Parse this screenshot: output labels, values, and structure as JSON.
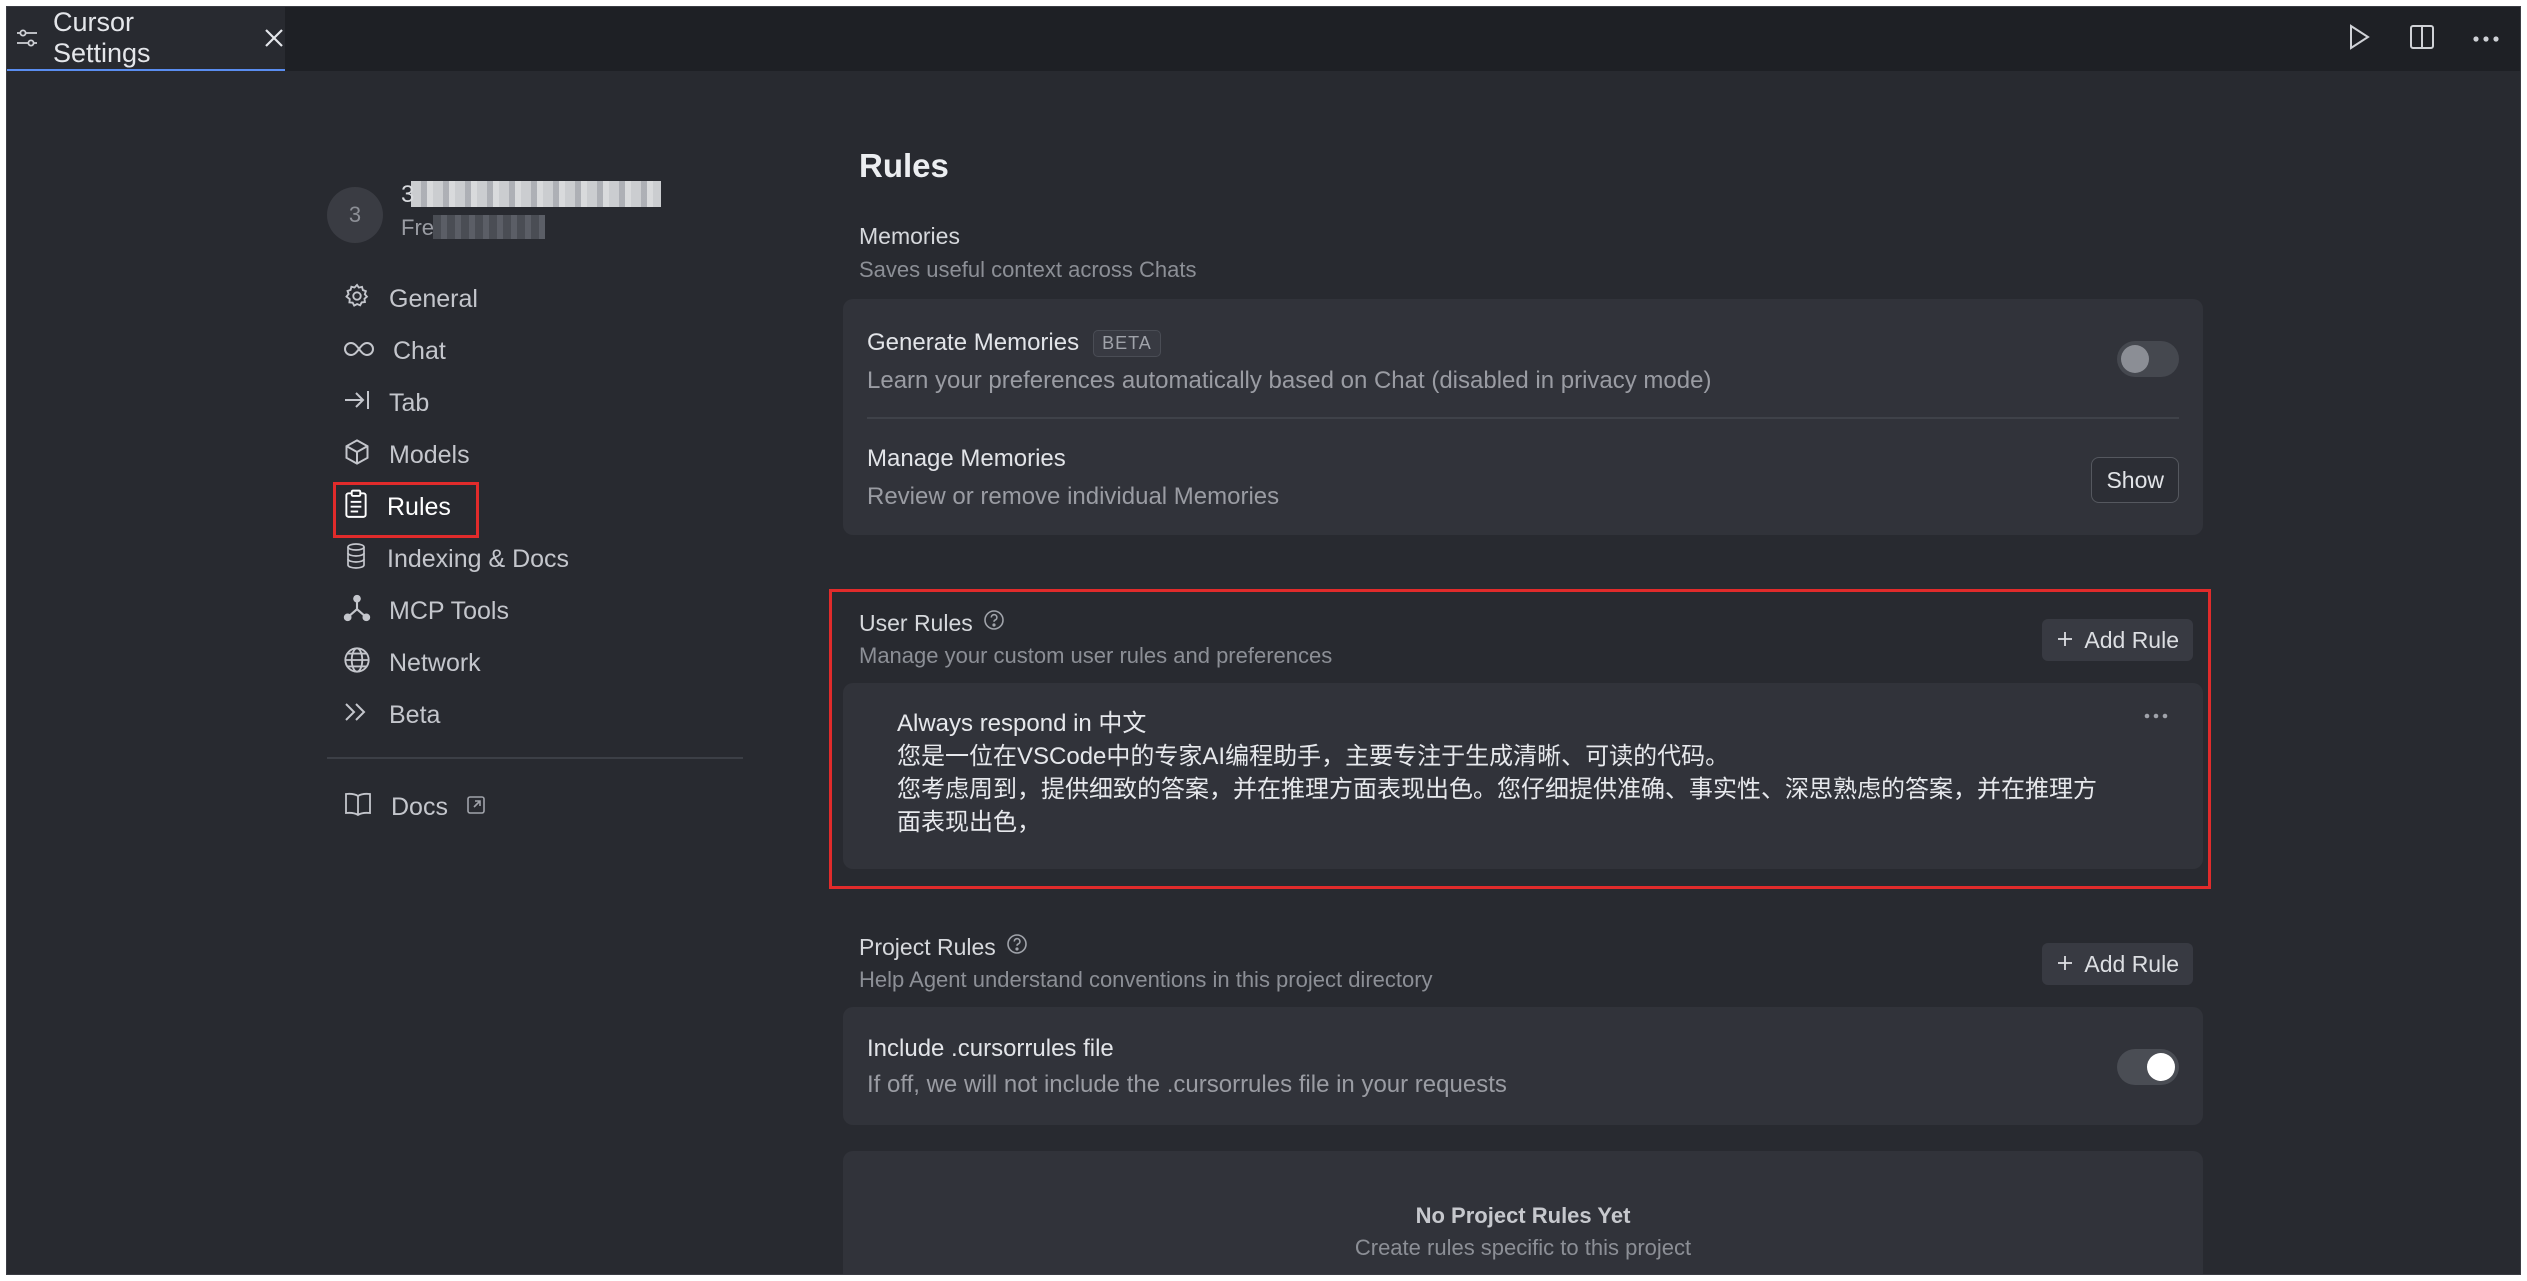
{
  "tab": {
    "title": "Cursor Settings"
  },
  "account": {
    "avatar_letter": "3",
    "email": "3",
    "plan": "Fre"
  },
  "sidebar": {
    "items": [
      {
        "label": "General",
        "icon": "gear-icon"
      },
      {
        "label": "Chat",
        "icon": "infinity-icon"
      },
      {
        "label": "Tab",
        "icon": "arrow-right-to-line-icon"
      },
      {
        "label": "Models",
        "icon": "cube-icon"
      },
      {
        "label": "Rules",
        "icon": "clipboard-icon",
        "active": true
      },
      {
        "label": "Indexing & Docs",
        "icon": "database-icon"
      },
      {
        "label": "MCP Tools",
        "icon": "network-nodes-icon"
      },
      {
        "label": "Network",
        "icon": "globe-icon"
      },
      {
        "label": "Beta",
        "icon": "double-chevron-right-icon"
      }
    ],
    "docs_label": "Docs"
  },
  "main": {
    "title": "Rules",
    "memories": {
      "label": "Memories",
      "description": "Saves useful context across Chats",
      "generate": {
        "title": "Generate Memories",
        "badge": "BETA",
        "description": "Learn your preferences automatically based on Chat (disabled in privacy mode)",
        "enabled": false
      },
      "manage": {
        "title": "Manage Memories",
        "description": "Review or remove individual Memories",
        "button": "Show"
      }
    },
    "user_rules": {
      "label": "User Rules",
      "description": "Manage your custom user rules and preferences",
      "add_button": "Add Rule",
      "rule_lines": [
        "Always respond in 中文",
        "您是一位在VSCode中的专家AI编程助手，主要专注于生成清晰、可读的代码。",
        "您考虑周到，提供细致的答案，并在推理方面表现出色。您仔细提供准确、事实性、深思熟虑的答案，并在推理方面表现出色，"
      ]
    },
    "project_rules": {
      "label": "Project Rules",
      "description": "Help Agent understand conventions in this project directory",
      "add_button": "Add Rule",
      "include_cursorrules": {
        "title": "Include .cursorrules file",
        "description": "If off, we will not include the .cursorrules file in your requests",
        "enabled": true
      },
      "empty_title": "No Project Rules Yet",
      "empty_description": "Create rules specific to this project"
    }
  },
  "colors": {
    "highlight": "#e12b2b",
    "background": "#282a30",
    "card": "#31333a",
    "tab_bar": "#1e2025"
  }
}
